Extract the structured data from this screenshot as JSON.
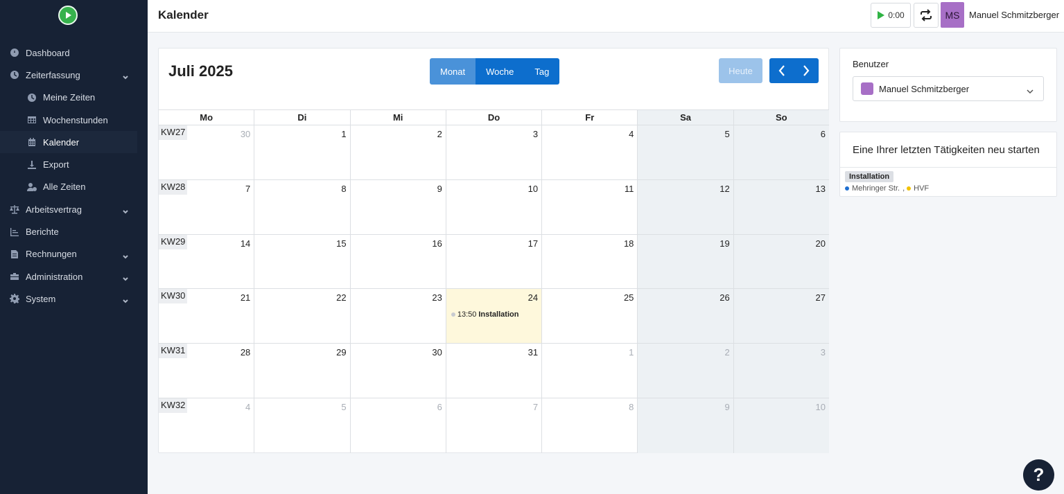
{
  "app": {
    "page_title": "Kalender",
    "timer_value": "0:00",
    "avatar_initials": "MS",
    "user_name": "Manuel Schmitzberger"
  },
  "sidebar": {
    "items": [
      {
        "label": "Dashboard",
        "icon": "dashboard-icon",
        "level": 0,
        "expandable": false
      },
      {
        "label": "Zeiterfassung",
        "icon": "clock-icon",
        "level": 0,
        "expandable": true
      },
      {
        "label": "Meine Zeiten",
        "icon": "clock-icon",
        "level": 1,
        "expandable": false
      },
      {
        "label": "Wochenstunden",
        "icon": "table-icon",
        "level": 1,
        "expandable": false
      },
      {
        "label": "Kalender",
        "icon": "calendar-icon",
        "level": 1,
        "expandable": false,
        "active": true
      },
      {
        "label": "Export",
        "icon": "download-icon",
        "level": 1,
        "expandable": false
      },
      {
        "label": "Alle Zeiten",
        "icon": "user-clock-icon",
        "level": 1,
        "expandable": false
      },
      {
        "label": "Arbeitsvertrag",
        "icon": "scale-icon",
        "level": 0,
        "expandable": true
      },
      {
        "label": "Berichte",
        "icon": "chart-icon",
        "level": 0,
        "expandable": false
      },
      {
        "label": "Rechnungen",
        "icon": "invoice-icon",
        "level": 0,
        "expandable": true
      },
      {
        "label": "Administration",
        "icon": "toolbox-icon",
        "level": 0,
        "expandable": true
      },
      {
        "label": "System",
        "icon": "gear-icon",
        "level": 0,
        "expandable": true
      }
    ]
  },
  "calendar": {
    "title": "Juli 2025",
    "views": [
      {
        "label": "Monat",
        "active": true
      },
      {
        "label": "Woche",
        "active": false
      },
      {
        "label": "Tag",
        "active": false
      }
    ],
    "today_label": "Heute",
    "weekdays": [
      "Mo",
      "Di",
      "Mi",
      "Do",
      "Fr",
      "Sa",
      "So"
    ],
    "weeks": [
      {
        "kw": "KW27",
        "days": [
          {
            "n": "30",
            "other": true
          },
          {
            "n": "1"
          },
          {
            "n": "2"
          },
          {
            "n": "3"
          },
          {
            "n": "4"
          },
          {
            "n": "5"
          },
          {
            "n": "6"
          }
        ]
      },
      {
        "kw": "KW28",
        "days": [
          {
            "n": "7"
          },
          {
            "n": "8"
          },
          {
            "n": "9"
          },
          {
            "n": "10"
          },
          {
            "n": "11"
          },
          {
            "n": "12"
          },
          {
            "n": "13"
          }
        ]
      },
      {
        "kw": "KW29",
        "days": [
          {
            "n": "14"
          },
          {
            "n": "15"
          },
          {
            "n": "16"
          },
          {
            "n": "17"
          },
          {
            "n": "18"
          },
          {
            "n": "19"
          },
          {
            "n": "20"
          }
        ]
      },
      {
        "kw": "KW30",
        "days": [
          {
            "n": "21"
          },
          {
            "n": "22"
          },
          {
            "n": "23"
          },
          {
            "n": "24",
            "today": true,
            "event": {
              "time": "13:50",
              "title": "Installation"
            }
          },
          {
            "n": "25"
          },
          {
            "n": "26"
          },
          {
            "n": "27"
          }
        ]
      },
      {
        "kw": "KW31",
        "days": [
          {
            "n": "28"
          },
          {
            "n": "29"
          },
          {
            "n": "30"
          },
          {
            "n": "31"
          },
          {
            "n": "1",
            "other": true
          },
          {
            "n": "2",
            "other": true
          },
          {
            "n": "3",
            "other": true
          }
        ]
      },
      {
        "kw": "KW32",
        "days": [
          {
            "n": "4",
            "other": true
          },
          {
            "n": "5",
            "other": true
          },
          {
            "n": "6",
            "other": true
          },
          {
            "n": "7",
            "other": true
          },
          {
            "n": "8",
            "other": true
          },
          {
            "n": "9",
            "other": true
          },
          {
            "n": "10",
            "other": true
          }
        ]
      }
    ]
  },
  "user_panel": {
    "label": "Benutzer",
    "selected_user": "Manuel Schmitzberger",
    "swatch_color": "#a76fc6"
  },
  "recent_panel": {
    "title": "Eine Ihrer letzten Tätigkeiten neu starten",
    "activity": "Installation",
    "project": "Mehringer Str.",
    "project_color": "#1f6fd0",
    "separator": ",",
    "customer": "HVF",
    "customer_color": "#f2c200"
  },
  "help": {
    "label": "?"
  }
}
